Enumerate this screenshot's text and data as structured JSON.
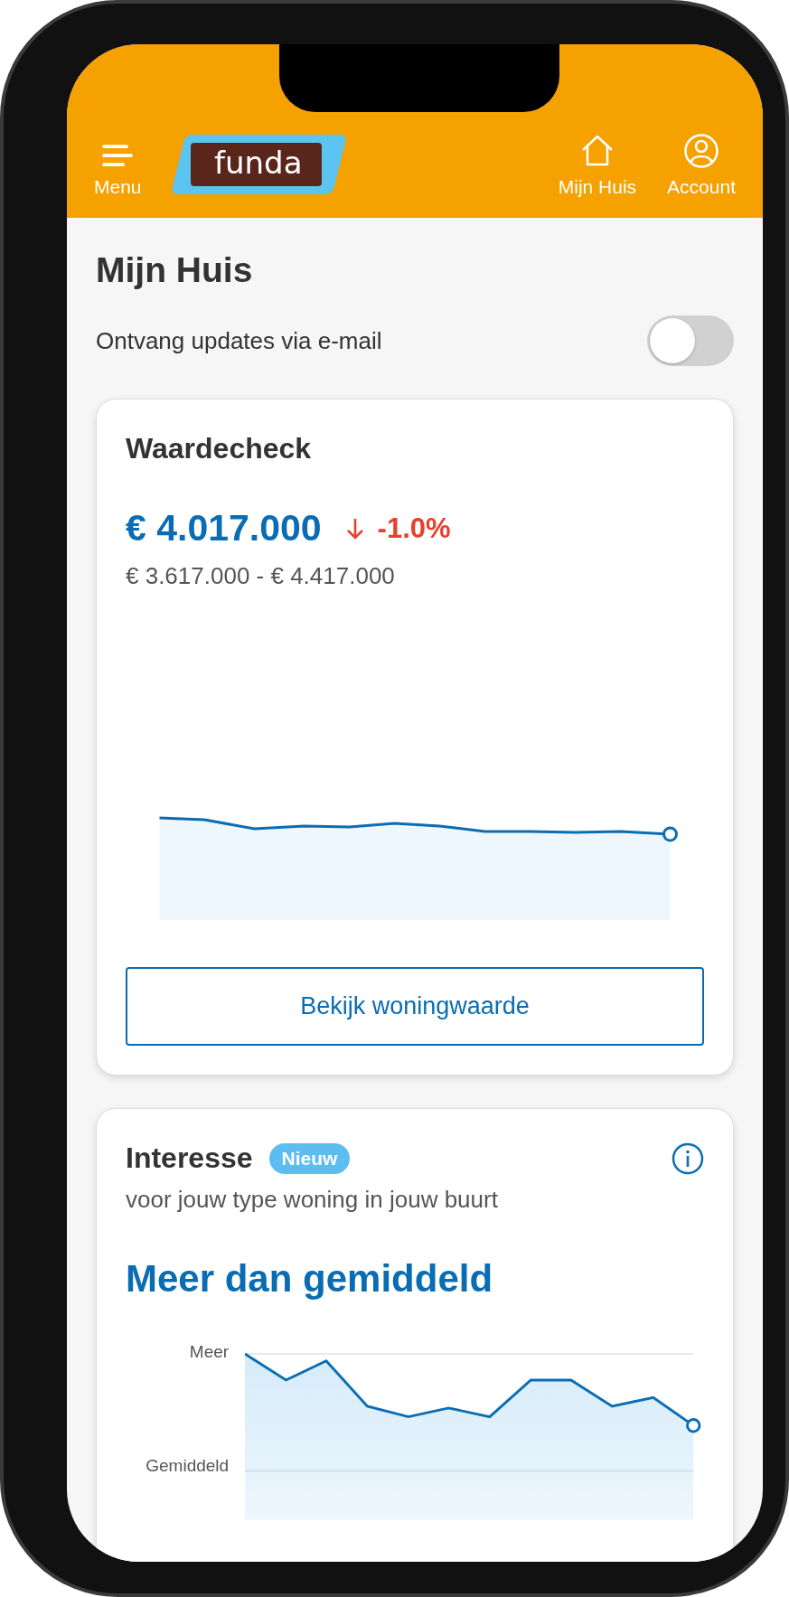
{
  "header": {
    "menu": "Menu",
    "logo": "funda",
    "nav": [
      {
        "kind": "home",
        "label": "Mijn Huis"
      },
      {
        "kind": "account",
        "label": "Account"
      }
    ]
  },
  "page_title": "Mijn Huis",
  "email_updates": {
    "label": "Ontvang updates via e-mail",
    "on": false
  },
  "value_card": {
    "title": "Waardecheck",
    "value": "€ 4.017.000",
    "change": "-1.0%",
    "down": true,
    "range": "€ 3.617.000 - € 4.417.000",
    "button": "Bekijk woningwaarde"
  },
  "interest_card": {
    "title": "Interesse",
    "badge": "Nieuw",
    "subtitle": "voor jouw type woning in jouw buurt",
    "verdict": "Meer dan gemiddeld",
    "axis_labels": [
      "Meer",
      "Gemiddeld"
    ]
  }
}
